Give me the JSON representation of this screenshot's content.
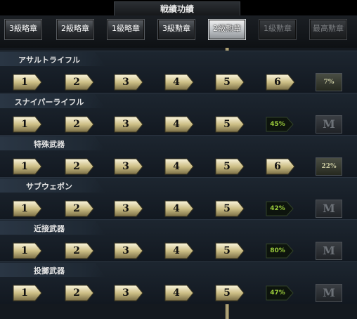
{
  "title": "戦績功績",
  "tabs": [
    {
      "label": "3級略章",
      "state": "normal"
    },
    {
      "label": "2級略章",
      "state": "normal"
    },
    {
      "label": "1級略章",
      "state": "normal"
    },
    {
      "label": "3級勲章",
      "state": "normal"
    },
    {
      "label": "2級勲章",
      "state": "active"
    },
    {
      "label": "1級勲章",
      "state": "disabled"
    },
    {
      "label": "最高勲章",
      "state": "disabled"
    }
  ],
  "rows": [
    {
      "label": "アサルトライフル",
      "levels": [
        "1",
        "2",
        "3",
        "4",
        "5",
        "6"
      ],
      "progress": null,
      "medal": "7%"
    },
    {
      "label": "スナイパーライフル",
      "levels": [
        "1",
        "2",
        "3",
        "4",
        "5"
      ],
      "progress": "45%",
      "medal": "M"
    },
    {
      "label": "特殊武器",
      "levels": [
        "1",
        "2",
        "3",
        "4",
        "5",
        "6"
      ],
      "progress": null,
      "medal": "22%"
    },
    {
      "label": "サブウェポン",
      "levels": [
        "1",
        "2",
        "3",
        "4",
        "5"
      ],
      "progress": "42%",
      "medal": "M"
    },
    {
      "label": "近接武器",
      "levels": [
        "1",
        "2",
        "3",
        "4",
        "5"
      ],
      "progress": "80%",
      "medal": "M"
    },
    {
      "label": "投擲武器",
      "levels": [
        "1",
        "2",
        "3",
        "4",
        "5"
      ],
      "progress": "47%",
      "medal": "M"
    }
  ],
  "colors": {
    "accent_gold": "#c6b98a",
    "progress_green": "#8cc43a",
    "active_tab": "#e6e6e6"
  }
}
